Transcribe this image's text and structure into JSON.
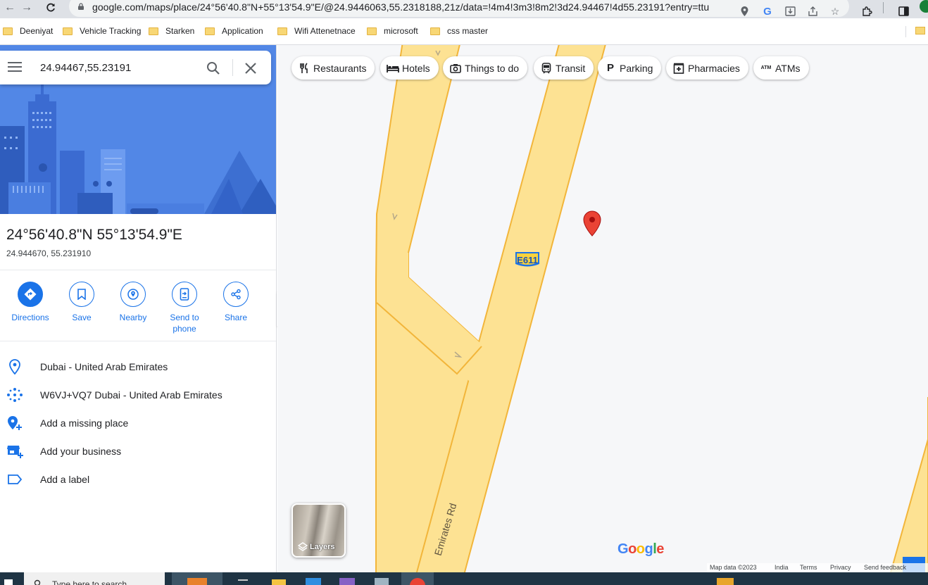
{
  "browser": {
    "url": "google.com/maps/place/24°56'40.8\"N+55°13'54.9\"E/@24.9446063,55.2318188,21z/data=!4m4!3m3!8m2!3d24.94467!4d55.23191?entry=ttu",
    "bookmarks": [
      "Deeniyat",
      "Vehicle Tracking",
      "Starken",
      "Application",
      "Wifi Attenetnace",
      "microsoft",
      "css master"
    ]
  },
  "search": {
    "query": "24.94467,55.23191"
  },
  "place": {
    "title": "24°56'40.8\"N 55°13'54.9\"E",
    "decimal": "24.944670, 55.231910"
  },
  "actions": [
    {
      "label": "Directions"
    },
    {
      "label": "Save"
    },
    {
      "label": "Nearby"
    },
    {
      "label": "Send to phone"
    },
    {
      "label": "Share"
    }
  ],
  "info": [
    {
      "text": "Dubai - United Arab Emirates",
      "icon": "location-pin-icon"
    },
    {
      "text": "W6VJ+VQ7 Dubai - United Arab Emirates",
      "icon": "plus-code-icon"
    },
    {
      "text": "Add a missing place",
      "icon": "add-place-icon"
    },
    {
      "text": "Add your business",
      "icon": "add-business-icon"
    },
    {
      "text": "Add a label",
      "icon": "label-icon"
    }
  ],
  "chips": [
    {
      "label": "Restaurants",
      "icon": "restaurant-icon"
    },
    {
      "label": "Hotels",
      "icon": "hotel-icon"
    },
    {
      "label": "Things to do",
      "icon": "camera-icon"
    },
    {
      "label": "Transit",
      "icon": "transit-icon"
    },
    {
      "label": "Parking",
      "icon": "parking-icon"
    },
    {
      "label": "Pharmacies",
      "icon": "pharmacy-icon"
    },
    {
      "label": "ATMs",
      "icon": "atm-icon"
    }
  ],
  "map": {
    "road_name": "Emirates Rd",
    "route_shield": "E611",
    "layers_label": "Layers",
    "google_logo": "Google",
    "footer": [
      "Map data ©2023",
      "India",
      "Terms",
      "Privacy",
      "Send feedback"
    ]
  },
  "taskbar": {
    "search_placeholder": "Type here to search"
  },
  "colors": {
    "accent": "#1a73e8",
    "road_fill": "#fde293",
    "road_border": "#f2b53a",
    "pin": "#ea4335",
    "hero": "#5287e6"
  }
}
